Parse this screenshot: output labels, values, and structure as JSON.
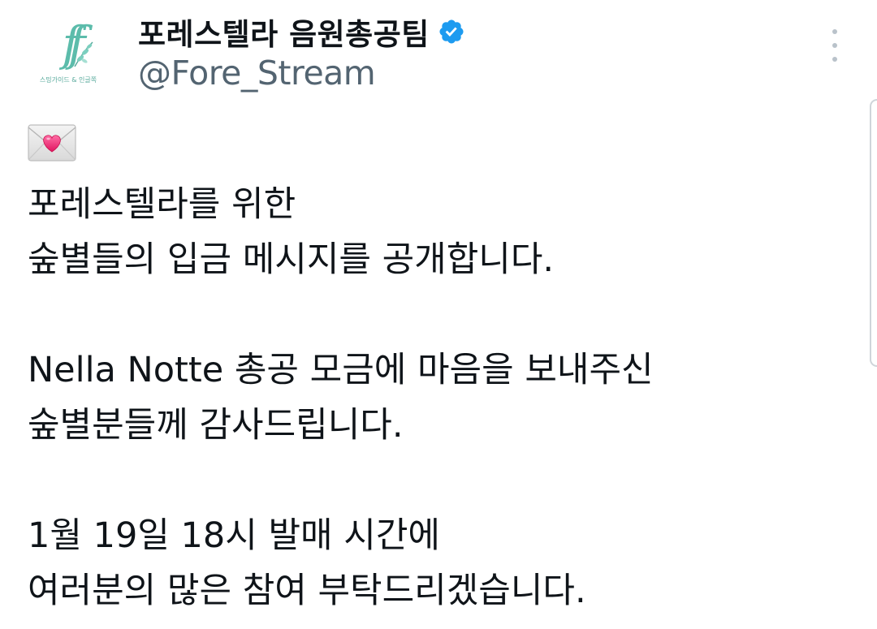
{
  "tweet": {
    "author": {
      "display_name": "포레스텔라 음원총공팀",
      "handle": "@Fore_Stream",
      "avatar_caption": "스밍가이드 & 인글쪽",
      "avatar_icon": "forestella-monogram-logo",
      "verified_icon": "verified-badge-icon",
      "verified_color": "#1d9bf0"
    },
    "more_icon": "more-vertical-icon",
    "emoji_icon": "love-letter-emoji",
    "body_lines": [
      "포레스텔라를 위한",
      "숲별들의 입금 메시지를 공개합니다.",
      "",
      "Nella Notte 총공 모금에 마음을 보내주신",
      "숲별분들께 감사드립니다.",
      "",
      "1월 19일 18시 발매 시간에",
      "여러분의 많은 참여 부탁드리겠습니다."
    ]
  },
  "colors": {
    "text_primary": "#0f1419",
    "text_secondary": "#536471",
    "accent": "#1d9bf0",
    "logo": "#5cbcab"
  }
}
